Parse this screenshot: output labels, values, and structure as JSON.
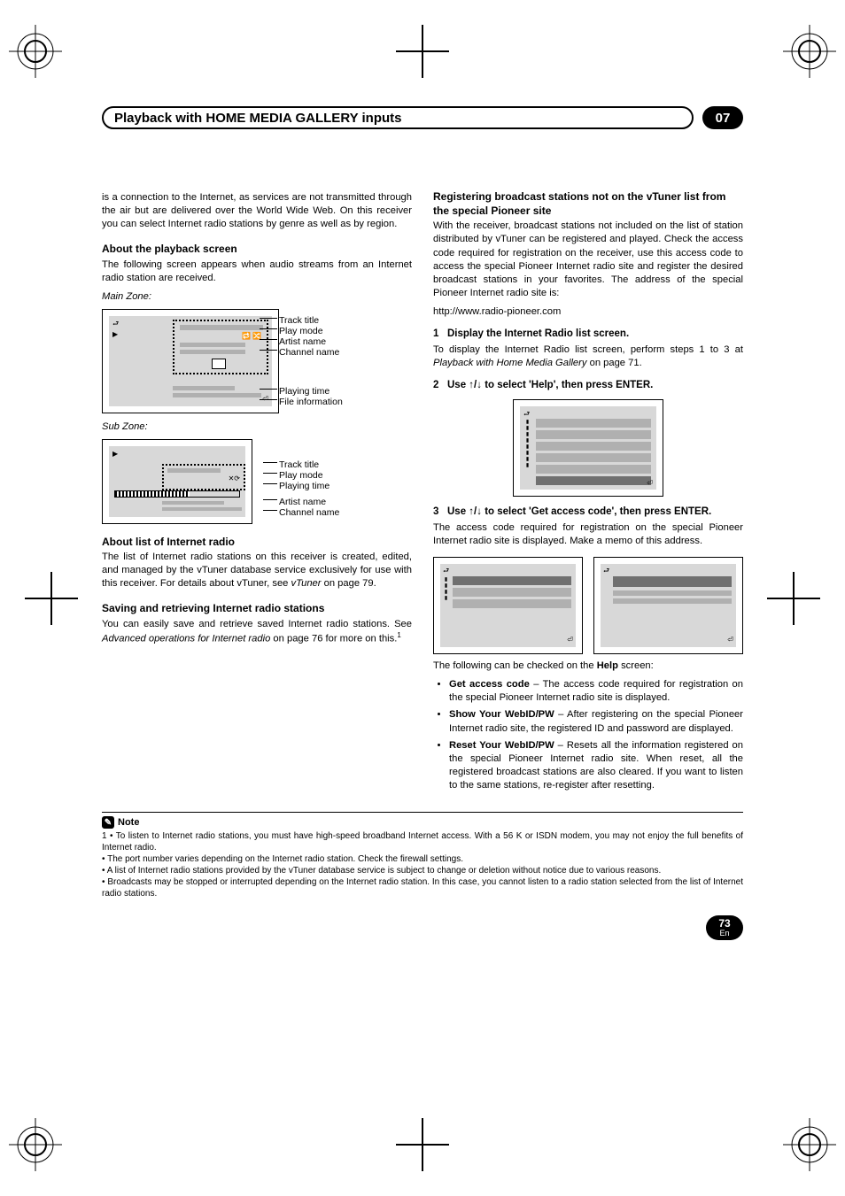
{
  "chapter": {
    "title": "Playback with HOME MEDIA GALLERY inputs",
    "number": "07"
  },
  "left": {
    "intro": "is a connection to the Internet, as services are not transmitted through the air but are delivered over the World Wide Web. On this receiver you can select Internet radio stations by genre as well as by region.",
    "h_playback": "About the playback screen",
    "p_playback": "The following screen appears when audio streams from an Internet radio station are received.",
    "main_zone_label": "Main Zone:",
    "sub_zone_label": "Sub Zone:",
    "fig_main_labels": {
      "track": "Track title",
      "playmode": "Play mode",
      "artist": "Artist name",
      "channel": "Channel name",
      "playtime": "Playing time",
      "fileinfo": "File information"
    },
    "fig_sub_labels": {
      "track": "Track title",
      "playmode": "Play mode",
      "playtime": "Playing time",
      "artist": "Artist name",
      "channel": "Channel name"
    },
    "h_list": "About list of Internet radio",
    "p_list_a": "The list of Internet radio stations on this receiver is created, edited, and managed by the vTuner database service exclusively for use with this receiver. For details about vTuner, see ",
    "p_list_i": "vTuner",
    "p_list_b": " on page 79.",
    "h_save": "Saving and retrieving Internet radio stations",
    "p_save_a": "You can easily save and retrieve saved Internet radio stations. See ",
    "p_save_i": "Advanced operations for Internet radio",
    "p_save_b": " on page 76 for more on this.",
    "p_save_fn": "1"
  },
  "right": {
    "h_reg": "Registering broadcast stations not on the vTuner list from the special Pioneer site",
    "p_reg": "With the receiver, broadcast stations not included on the list of station distributed by vTuner can be registered and played. Check the access code required for registration on the receiver, use this access code to access the special Pioneer Internet radio site and register the desired broadcast stations in your favorites. The address of the special Pioneer Internet radio site is:",
    "url": "http://www.radio-pioneer.com",
    "step1_num": "1",
    "step1_title": "Display the Internet Radio list screen.",
    "step1_body_a": "To display the Internet Radio list screen, perform steps 1 to 3 at ",
    "step1_body_i": "Playback with Home Media Gallery",
    "step1_body_b": " on page 71.",
    "step2_num": "2",
    "step2_title_a": "Use ",
    "step2_arrows": "↑/↓",
    "step2_title_b": " to select 'Help', then press ENTER.",
    "step3_num": "3",
    "step3_title_a": "Use ",
    "step3_arrows": "↑/↓",
    "step3_title_b": " to select 'Get access code', then press ENTER.",
    "step3_body": "The access code required for registration on the special Pioneer Internet radio site is displayed. Make a memo of this address.",
    "help_intro_a": "The following can be checked on the ",
    "help_intro_b": "Help",
    "help_intro_c": " screen:",
    "bullets": [
      {
        "term": "Get access code",
        "text": " – The access code required for registration on the special Pioneer Internet radio site is displayed."
      },
      {
        "term": "Show Your WebID/PW",
        "text": " – After registering on the special Pioneer Internet radio site, the registered ID and password are displayed."
      },
      {
        "term": "Reset Your WebID/PW",
        "text": " – Resets all the information registered on the special Pioneer Internet radio site. When reset, all the registered broadcast stations are also cleared. If you want to listen to the same stations, re-register after resetting."
      }
    ]
  },
  "note": {
    "label": "Note",
    "fn_num": "1",
    "lines": [
      "• To listen to Internet radio stations, you must have high-speed broadband Internet access. With a 56 K or ISDN modem, you may not enjoy the full benefits of Internet radio.",
      "• The port number varies depending on the Internet radio station. Check the firewall settings.",
      "• A list of Internet radio stations provided by the vTuner database service is subject to change or deletion without notice due to various reasons.",
      "• Broadcasts may be stopped or interrupted depending on the Internet radio station. In this case, you cannot listen to a radio station selected from the list of Internet radio stations."
    ]
  },
  "page": {
    "num": "73",
    "lang": "En"
  }
}
